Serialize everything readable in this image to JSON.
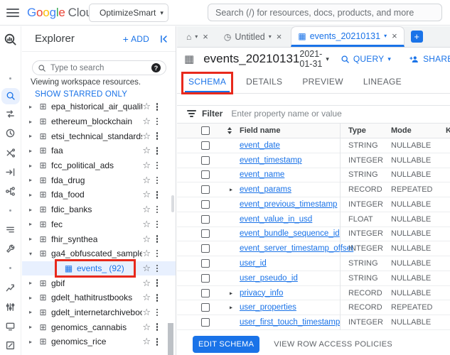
{
  "colors": {
    "accent": "#1a73e8",
    "annotation": "#e8291c",
    "selected_bg": "#e8f0fe",
    "tab_strip_bg": "#f1f3f4"
  },
  "icons": {
    "dataset": "⊞",
    "table": "▦",
    "star": "☆",
    "caret_right": "▸",
    "caret_down": "▾",
    "dropdown": "▾",
    "close": "×",
    "home": "⌂",
    "query": "◷",
    "plus": "+",
    "help": "?"
  },
  "header": {
    "logo_letters": [
      {
        "ch": "G",
        "color": "#4285F4"
      },
      {
        "ch": "o",
        "color": "#EA4335"
      },
      {
        "ch": "o",
        "color": "#FBBC05"
      },
      {
        "ch": "g",
        "color": "#4285F4"
      },
      {
        "ch": "l",
        "color": "#34A853"
      },
      {
        "ch": "e",
        "color": "#EA4335"
      }
    ],
    "logo_cloud": "Cloud",
    "project_name": "OptimizeSmart",
    "search_placeholder": "Search (/) for resources, docs, products, and more"
  },
  "rail": {
    "items": [
      "bigquery-logo",
      "separator-dot",
      "search",
      "compare-arrows",
      "scheduled-queries",
      "analytics-hub",
      "data-transfers",
      "dataform",
      "separator-dot",
      "migration-list",
      "admin-wrench",
      "separator-dot",
      "capacity-chart",
      "bi-engine",
      "monitoring",
      "compose"
    ]
  },
  "explorer": {
    "title": "Explorer",
    "add_label": "ADD",
    "search_placeholder": "Type to search",
    "viewing_text": "Viewing workspace resources.",
    "starred_link": "SHOW STARRED ONLY",
    "tree": [
      {
        "label": "epa_historical_air_quality",
        "kind": "dataset"
      },
      {
        "label": "ethereum_blockchain",
        "kind": "dataset"
      },
      {
        "label": "etsi_technical_standards",
        "kind": "dataset"
      },
      {
        "label": "faa",
        "kind": "dataset"
      },
      {
        "label": "fcc_political_ads",
        "kind": "dataset"
      },
      {
        "label": "fda_drug",
        "kind": "dataset"
      },
      {
        "label": "fda_food",
        "kind": "dataset"
      },
      {
        "label": "fdic_banks",
        "kind": "dataset"
      },
      {
        "label": "fec",
        "kind": "dataset"
      },
      {
        "label": "fhir_synthea",
        "kind": "dataset"
      },
      {
        "label": "ga4_obfuscated_sample...",
        "kind": "dataset",
        "expanded": true
      },
      {
        "label": "events_ (92)",
        "kind": "table",
        "selected": true,
        "annotated": true
      },
      {
        "label": "gbif",
        "kind": "dataset"
      },
      {
        "label": "gdelt_hathitrustbooks",
        "kind": "dataset"
      },
      {
        "label": "gdelt_internetarchiveboo...",
        "kind": "dataset"
      },
      {
        "label": "genomics_cannabis",
        "kind": "dataset"
      },
      {
        "label": "genomics_rice",
        "kind": "dataset"
      }
    ]
  },
  "editor_tabs": {
    "tabs": [
      {
        "kind": "home"
      },
      {
        "kind": "query",
        "label": "Untitled"
      },
      {
        "kind": "table",
        "label": "events_20210131",
        "active": true
      }
    ]
  },
  "toolbar": {
    "title": "events_20210131",
    "date": "2021-01-31",
    "query_label": "QUERY",
    "share_label": "SHARE"
  },
  "view_tabs": [
    {
      "label": "SCHEMA",
      "active": true,
      "annotated": true
    },
    {
      "label": "DETAILS"
    },
    {
      "label": "PREVIEW"
    },
    {
      "label": "LINEAGE"
    }
  ],
  "filter": {
    "label": "Filter",
    "placeholder": "Enter property name or value"
  },
  "schema_table": {
    "columns": [
      "Field name",
      "Type",
      "Mode",
      "K"
    ],
    "rows": [
      {
        "name": "event_date",
        "type": "STRING",
        "mode": "NULLABLE",
        "expandable": false
      },
      {
        "name": "event_timestamp",
        "type": "INTEGER",
        "mode": "NULLABLE",
        "expandable": false
      },
      {
        "name": "event_name",
        "type": "STRING",
        "mode": "NULLABLE",
        "expandable": false
      },
      {
        "name": "event_params",
        "type": "RECORD",
        "mode": "REPEATED",
        "expandable": true
      },
      {
        "name": "event_previous_timestamp",
        "type": "INTEGER",
        "mode": "NULLABLE",
        "expandable": false
      },
      {
        "name": "event_value_in_usd",
        "type": "FLOAT",
        "mode": "NULLABLE",
        "expandable": false
      },
      {
        "name": "event_bundle_sequence_id",
        "type": "INTEGER",
        "mode": "NULLABLE",
        "expandable": false
      },
      {
        "name": "event_server_timestamp_offset",
        "type": "INTEGER",
        "mode": "NULLABLE",
        "expandable": false
      },
      {
        "name": "user_id",
        "type": "STRING",
        "mode": "NULLABLE",
        "expandable": false
      },
      {
        "name": "user_pseudo_id",
        "type": "STRING",
        "mode": "NULLABLE",
        "expandable": false
      },
      {
        "name": "privacy_info",
        "type": "RECORD",
        "mode": "NULLABLE",
        "expandable": true
      },
      {
        "name": "user_properties",
        "type": "RECORD",
        "mode": "REPEATED",
        "expandable": true
      },
      {
        "name": "user_first_touch_timestamp",
        "type": "INTEGER",
        "mode": "NULLABLE",
        "expandable": false
      }
    ]
  },
  "footer": {
    "edit_schema": "EDIT SCHEMA",
    "view_policies": "VIEW ROW ACCESS POLICIES"
  }
}
